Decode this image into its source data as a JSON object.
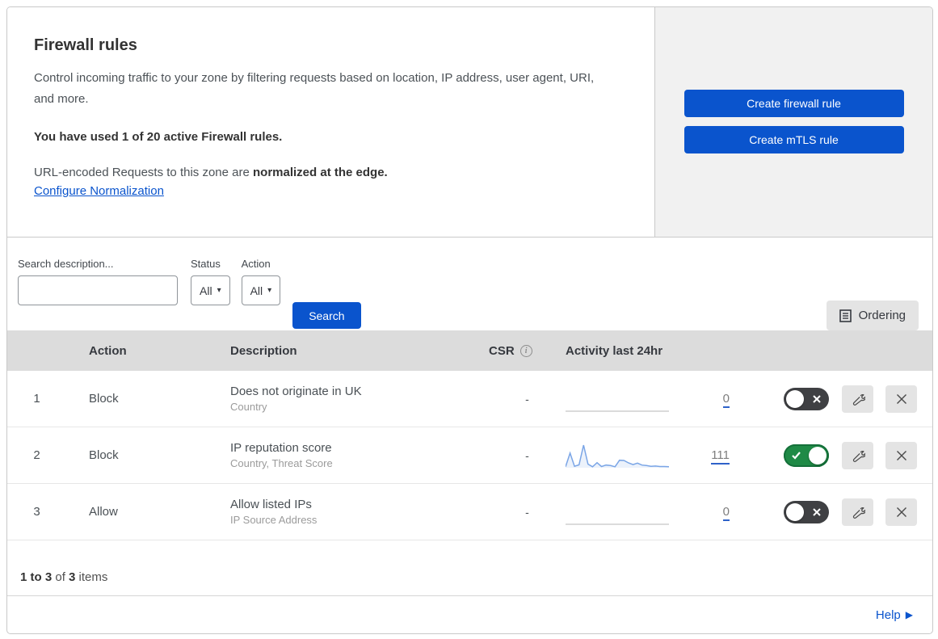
{
  "header": {
    "title": "Firewall rules",
    "description": "Control incoming traffic to your zone by filtering requests based on location, IP address, user agent, URI, and more.",
    "usage": "You have used 1 of 20 active Firewall rules.",
    "norm_prefix": "URL-encoded Requests to this zone are ",
    "norm_bold": "normalized at the edge.",
    "norm_link": "Configure Normalization"
  },
  "actions_panel": {
    "create_firewall_label": "Create firewall rule",
    "create_mtls_label": "Create mTLS rule"
  },
  "filters": {
    "search_label": "Search description...",
    "search_placeholder": "",
    "status_label": "Status",
    "status_value": "All",
    "action_label": "Action",
    "action_value": "All",
    "search_button": "Search",
    "ordering_button": "Ordering"
  },
  "table": {
    "columns": {
      "action": "Action",
      "description": "Description",
      "csr": "CSR",
      "activity": "Activity last 24hr"
    },
    "rows": [
      {
        "priority": "1",
        "action": "Block",
        "description": "Does not originate in UK",
        "fields": "Country",
        "csr": "-",
        "activity_count": "0",
        "enabled": false,
        "sparkline": [
          0,
          0,
          0,
          0,
          0,
          0,
          0,
          0,
          0,
          0,
          0,
          0,
          0,
          0,
          0,
          0,
          0,
          0,
          0,
          0,
          0,
          0,
          0,
          0
        ]
      },
      {
        "priority": "2",
        "action": "Block",
        "description": "IP reputation score",
        "fields": "Country, Threat Score",
        "csr": "-",
        "activity_count": "111",
        "enabled": true,
        "sparkline": [
          0.4,
          6.0,
          0.6,
          1.2,
          9.3,
          1.5,
          0.4,
          2.1,
          0.5,
          1.1,
          0.9,
          0.4,
          3.1,
          3.0,
          2.0,
          1.3,
          1.9,
          1.1,
          0.9,
          0.6,
          0.7,
          0.5,
          0.5,
          0.4
        ]
      },
      {
        "priority": "3",
        "action": "Allow",
        "description": "Allow listed IPs",
        "fields": "IP Source Address",
        "csr": "-",
        "activity_count": "0",
        "enabled": false,
        "sparkline": [
          0,
          0,
          0,
          0,
          0,
          0,
          0,
          0,
          0,
          0,
          0,
          0,
          0,
          0,
          0,
          0,
          0,
          0,
          0,
          0,
          0,
          0,
          0,
          0
        ]
      }
    ]
  },
  "chart_data": {
    "type": "line",
    "title": "Activity last 24hr sparkline (rule 2)",
    "x_unit": "last 24 hours, evenly spaced samples",
    "values": [
      0.4,
      6.0,
      0.6,
      1.2,
      9.3,
      1.5,
      0.4,
      2.1,
      0.5,
      1.1,
      0.9,
      0.4,
      3.1,
      3.0,
      2.0,
      1.3,
      1.9,
      1.1,
      0.9,
      0.6,
      0.7,
      0.5,
      0.5,
      0.4
    ],
    "total_label": "111",
    "ylim": [
      0,
      10
    ],
    "grid": false,
    "legend": false
  },
  "footer": {
    "range_bold": "1 to 3",
    "of_text": " of ",
    "total_bold": "3",
    "items_text": " items",
    "help_label": "Help"
  },
  "colors": {
    "primary_blue": "#0a54cd",
    "link_blue": "#0a54cd",
    "toggle_on_green": "#1f8a46",
    "toggle_off_gray": "#3f4043",
    "sparkline_blue": "#7aa5e6",
    "sparkline_fill": "rgba(122,165,230,0.14)",
    "sparkline_flat_gray": "#cfcfcf",
    "panel_gray": "#f1f1f1",
    "table_header_gray": "#dcdcdc"
  }
}
